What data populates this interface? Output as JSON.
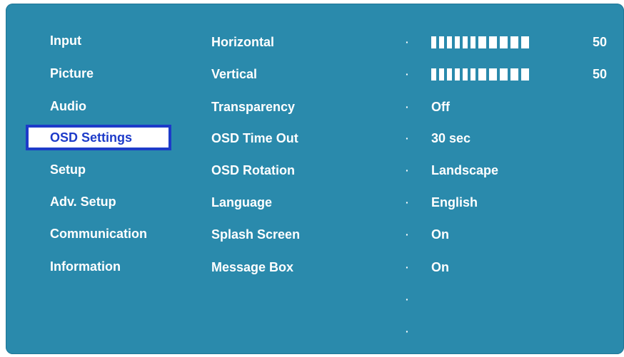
{
  "main_menu": [
    {
      "label": "Input"
    },
    {
      "label": "Picture"
    },
    {
      "label": "Audio"
    },
    {
      "label": "OSD Settings"
    },
    {
      "label": "Setup"
    },
    {
      "label": "Adv. Setup"
    },
    {
      "label": "Communication"
    },
    {
      "label": "Information"
    }
  ],
  "selected_main": "OSD Settings",
  "sub_menu": [
    {
      "label": "Horizontal"
    },
    {
      "label": "Vertical"
    },
    {
      "label": "Transparency"
    },
    {
      "label": "OSD Time Out"
    },
    {
      "label": "OSD Rotation"
    },
    {
      "label": "Language"
    },
    {
      "label": "Splash Screen"
    },
    {
      "label": "Message Box"
    }
  ],
  "values": [
    {
      "type": "bar",
      "level": 50,
      "label": "50"
    },
    {
      "type": "bar",
      "level": 50,
      "label": "50"
    },
    {
      "type": "text",
      "label": "Off"
    },
    {
      "type": "text",
      "label": "30 sec"
    },
    {
      "type": "text",
      "label": "Landscape"
    },
    {
      "type": "text",
      "label": "English"
    },
    {
      "type": "text",
      "label": "On"
    },
    {
      "type": "text",
      "label": "On"
    },
    {
      "type": "empty",
      "label": ""
    },
    {
      "type": "empty",
      "label": ""
    }
  ],
  "bullet_glyph": "·",
  "colors": {
    "background": "#2a8aac",
    "text": "#ffffff",
    "selection_border": "#1d3bc9"
  }
}
